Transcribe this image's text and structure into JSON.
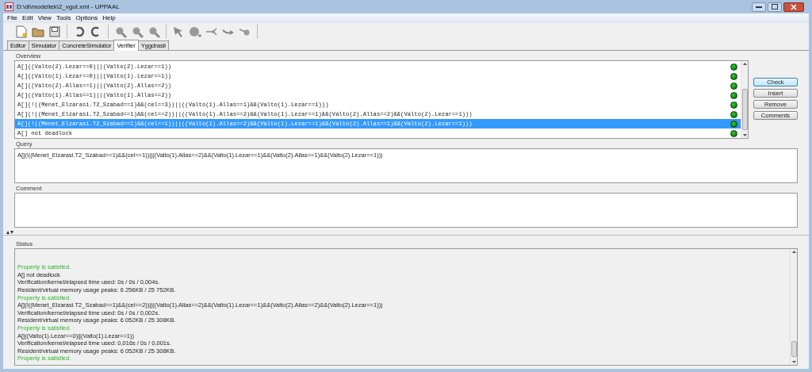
{
  "window": {
    "title": "D:\\di\\modellek\\2_vgut.xml - UPPAAL"
  },
  "menu": [
    "File",
    "Edit",
    "View",
    "Tools",
    "Options",
    "Help"
  ],
  "tabs": [
    {
      "label": "Editor",
      "selected": false
    },
    {
      "label": "Simulator",
      "selected": false
    },
    {
      "label": "ConcreteSimulator",
      "selected": false
    },
    {
      "label": "Verifier",
      "selected": true
    },
    {
      "label": "Yggdrasil",
      "selected": false
    }
  ],
  "overview": {
    "label": "Overview",
    "rows": [
      {
        "query": "A[]((Valto(2).Lezar==0)||(Valto(2).Lezar==1))",
        "satisfied": true,
        "selected": false
      },
      {
        "query": "A[]((Valto(1).Lezar==0)||(Valto(1).Lezar==1))",
        "satisfied": true,
        "selected": false
      },
      {
        "query": "A[]((Valto(2).Allas==1)||(Valto(2).Allas==2))",
        "satisfied": true,
        "selected": false
      },
      {
        "query": "A[]((Valto(1).Allas==1)||(Valto(1).Allas==2))",
        "satisfied": true,
        "selected": false
      },
      {
        "query": "A[](!((Menet_Elzarasi.T2_Szabad==1)&&(cel==3))||((Valto(1).Allas==1)&&(Valto(1).Lezar==1)))",
        "satisfied": true,
        "selected": false
      },
      {
        "query": "A[](!((Menet_Elzarasi.T2_Szabad==1)&&(cel==2))||((Valto(1).Allas==2)&&(Valto(1).Lezar==1)&&(Valto(2).Allas==2)&&(Valto(2).Lezar==1)))",
        "satisfied": true,
        "selected": false
      },
      {
        "query": "A[](!((Menet_Elzarasi.T2_Szabad==1)&&(cel==1))||((Valto(1).Allas==2)&&(Valto(1).Lezar==1)&&(Valto(2).Allas==1)&&(Valto(2).Lezar==1)))",
        "satisfied": true,
        "selected": true
      },
      {
        "query": "A[] not deadlock",
        "satisfied": true,
        "selected": false
      }
    ]
  },
  "buttons": [
    "Check",
    "Insert",
    "Remove",
    "Comments"
  ],
  "query": {
    "label": "Query",
    "value": "A[](!((Menet_Elzarasi.T2_Szabad==1)&&(cel==1))||((Valto(1).Allas==2)&&(Valto(1).Lezar==1)&&(Valto(2).Allas==1)&&(Valto(2).Lezar==1)))"
  },
  "comment": {
    "label": "Comment"
  },
  "status": {
    "label": "Status",
    "lines": [
      {
        "kind": "result",
        "text": "Property is satisfied."
      },
      {
        "kind": "text",
        "text": "A[] not deadlock"
      },
      {
        "kind": "text",
        "text": "Verification/kernel/elapsed time used: 0s / 0s / 0,004s."
      },
      {
        "kind": "text",
        "text": "Resident/virtual memory usage peaks: 6 256KB / 25 752KB."
      },
      {
        "kind": "result",
        "text": "Property is satisfied."
      },
      {
        "kind": "text",
        "text": "A[](!((Menet_Elzarasi.T2_Szabad==1)&&(cel==2))||((Valto(1).Allas==2)&&(Valto(1).Lezar==1)&&(Valto(2).Allas==2)&&(Valto(2).Lezar==1)))"
      },
      {
        "kind": "text",
        "text": "Verification/kernel/elapsed time used: 0s / 0s / 0,002s."
      },
      {
        "kind": "text",
        "text": "Resident/virtual memory usage peaks: 6 052KB / 25 308KB."
      },
      {
        "kind": "result",
        "text": "Property is satisfied."
      },
      {
        "kind": "text",
        "text": "A[]((Valto(1).Lezar==0)||(Valto(1).Lezar==1))"
      },
      {
        "kind": "text",
        "text": "Verification/kernel/elapsed time used: 0,016s / 0s / 0,001s."
      },
      {
        "kind": "text",
        "text": "Resident/virtual memory usage peaks: 6 052KB / 25 308KB."
      },
      {
        "kind": "result",
        "text": "Property is satisfied."
      }
    ]
  }
}
